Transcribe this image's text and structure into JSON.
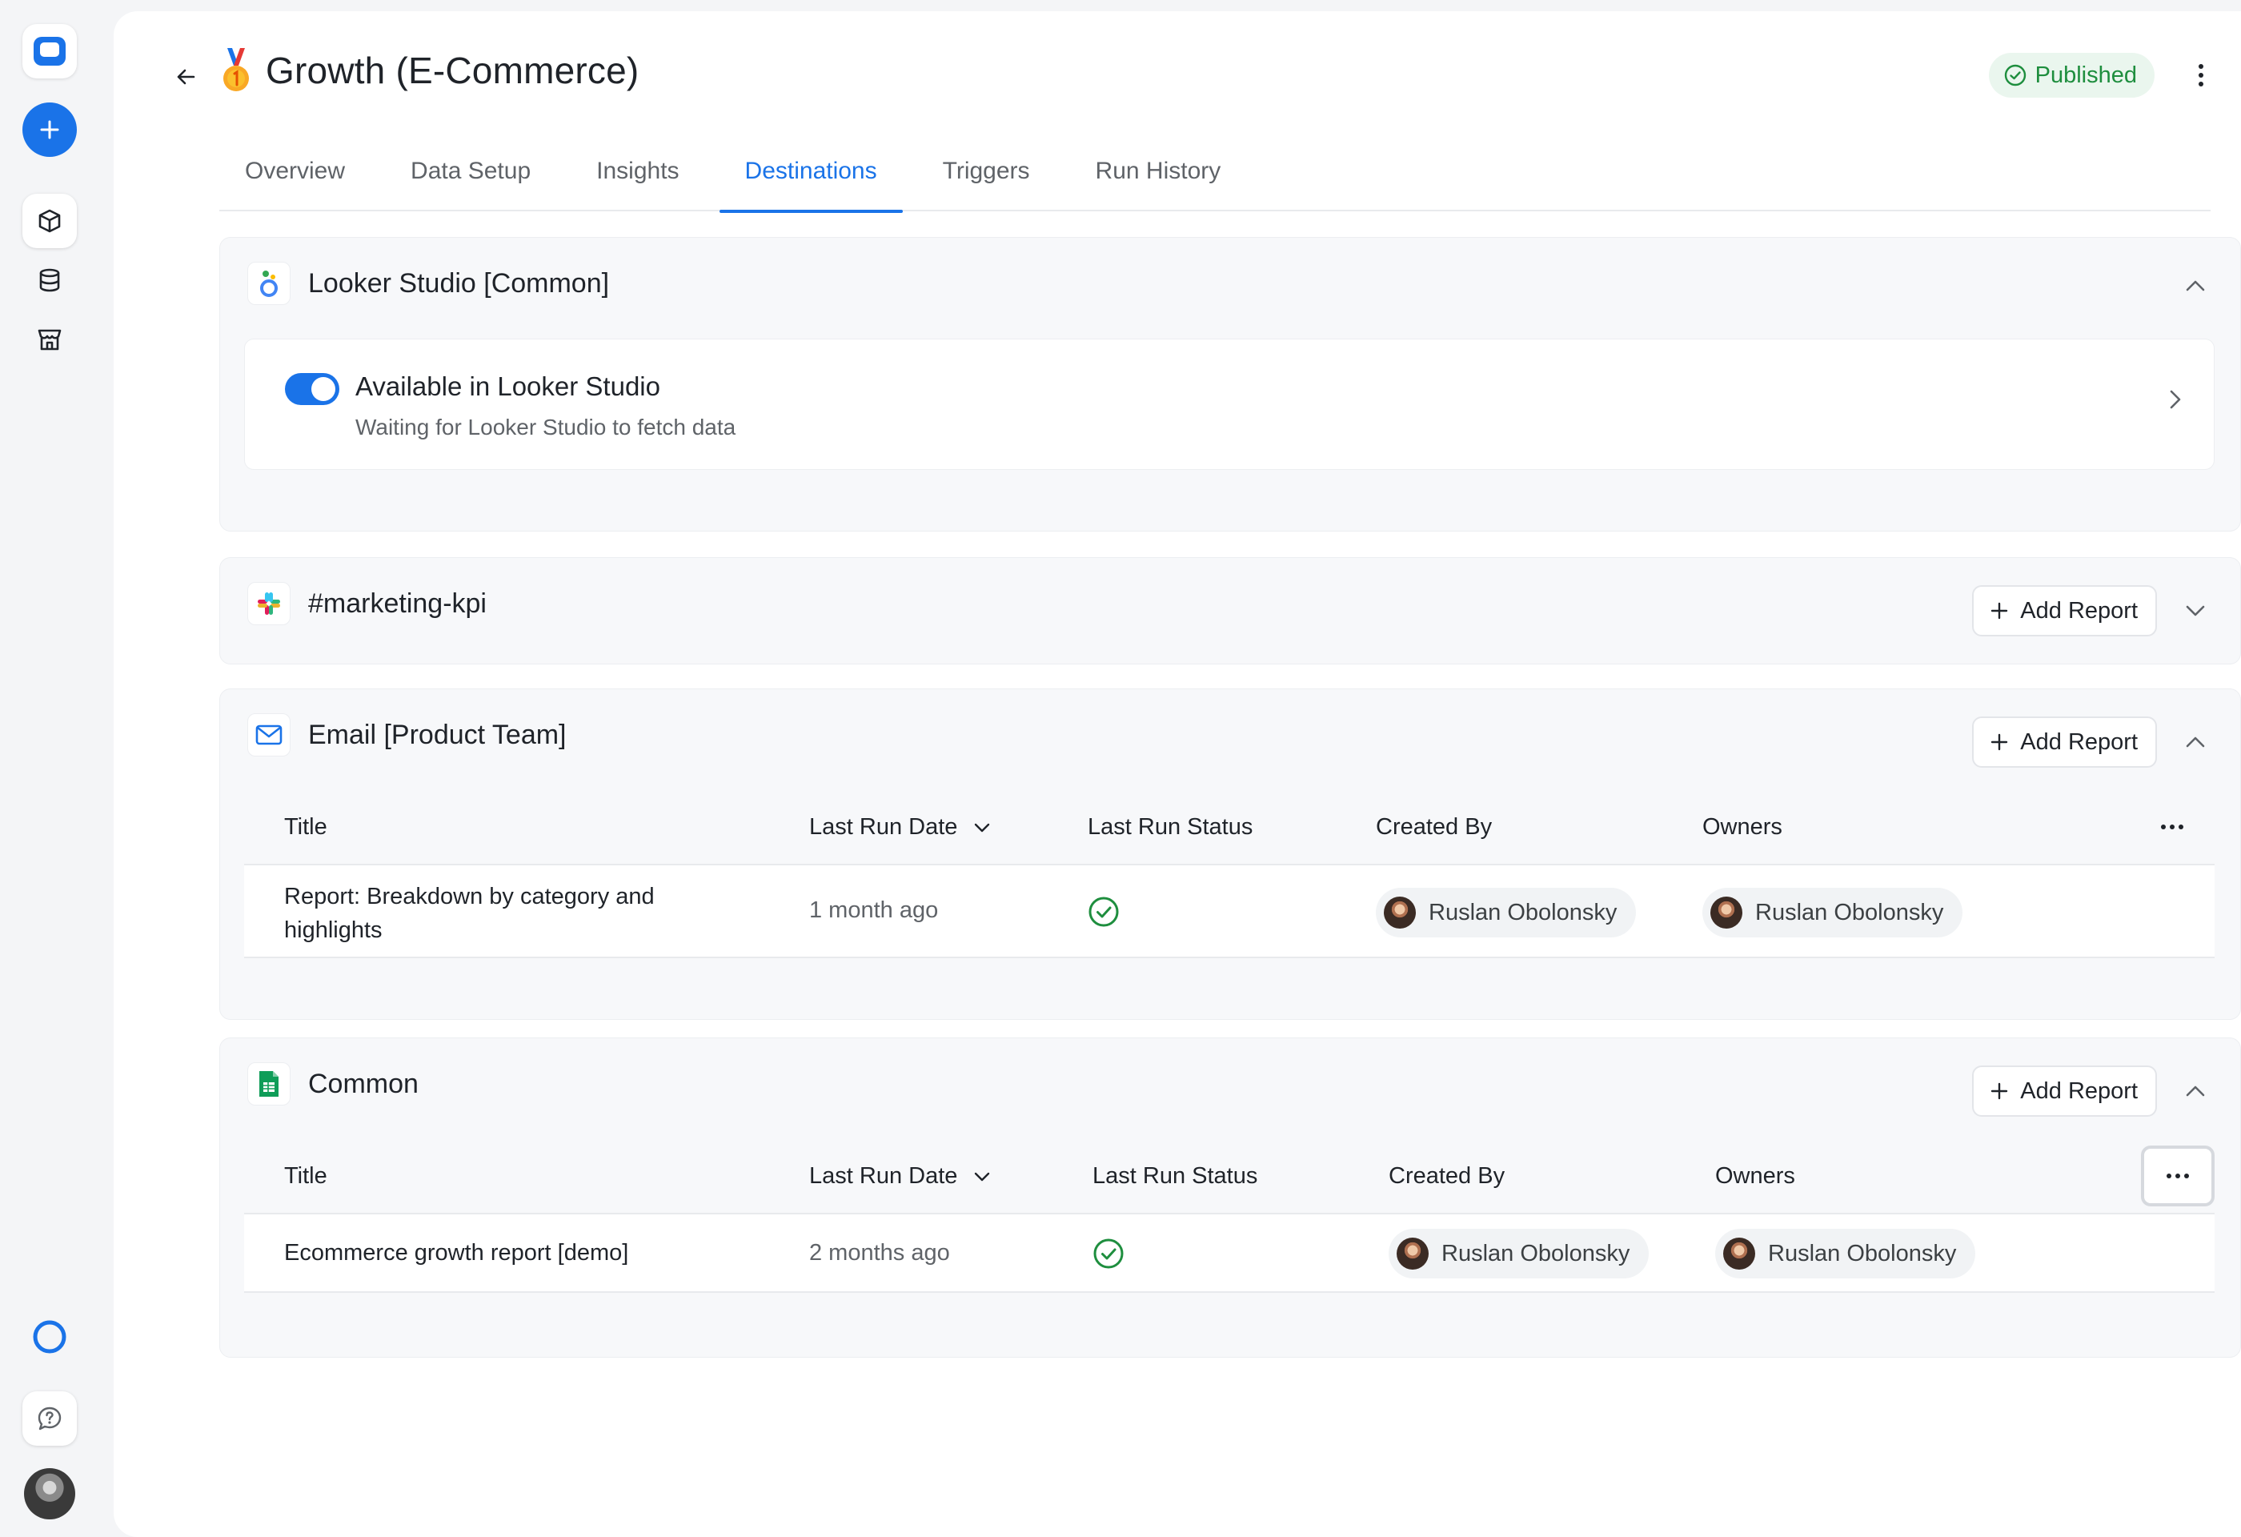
{
  "header": {
    "title": "Growth (E-Commerce)",
    "status": "Published"
  },
  "tabs": [
    {
      "label": "Overview"
    },
    {
      "label": "Data Setup"
    },
    {
      "label": "Insights"
    },
    {
      "label": "Destinations"
    },
    {
      "label": "Triggers"
    },
    {
      "label": "Run History"
    }
  ],
  "active_tab": "Destinations",
  "destinations": {
    "looker": {
      "title": "Looker Studio [Common]",
      "row_title": "Available in Looker Studio",
      "row_subtitle": "Waiting for Looker Studio to fetch data",
      "toggle_on": true
    },
    "slack": {
      "title": "#marketing-kpi",
      "add_label": "Add Report"
    },
    "email": {
      "title": "Email [Product Team]",
      "add_label": "Add Report",
      "columns": [
        "Title",
        "Last Run Date",
        "Last Run Status",
        "Created By",
        "Owners"
      ],
      "rows": [
        {
          "title_line1": "Report: Breakdown by category and",
          "title_line2": "highlights",
          "last_run": "1 month ago",
          "status": "success",
          "created_by": "Ruslan Obolonsky",
          "owner": "Ruslan Obolonsky"
        }
      ]
    },
    "sheets": {
      "title": "Common",
      "add_label": "Add Report",
      "columns": [
        "Title",
        "Last Run Date",
        "Last Run Status",
        "Created By",
        "Owners"
      ],
      "rows": [
        {
          "title": "Ecommerce growth report [demo]",
          "last_run": "2 months ago",
          "status": "success",
          "created_by": "Ruslan Obolonsky",
          "owner": "Ruslan Obolonsky"
        }
      ]
    }
  },
  "colors": {
    "accent": "#1a73e8",
    "success": "#1e8e3e",
    "badge_bg": "#eaf6ee"
  }
}
